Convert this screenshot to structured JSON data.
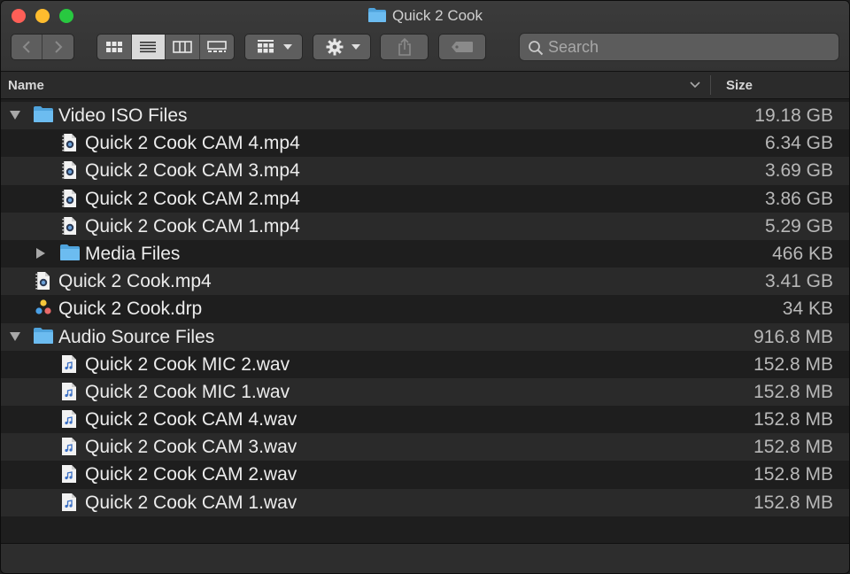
{
  "window": {
    "title": "Quick 2 Cook"
  },
  "toolbar": {
    "view_modes": [
      "icon-view",
      "list-view",
      "column-view",
      "gallery-view"
    ],
    "active_view": "list-view",
    "search_placeholder": "Search"
  },
  "columns": {
    "name": "Name",
    "size": "Size"
  },
  "rows": [
    {
      "name": "Video ISO Files",
      "size": "19.18 GB",
      "kind": "folder",
      "level": 0,
      "disclosure": "open"
    },
    {
      "name": "Quick 2 Cook CAM 4.mp4",
      "size": "6.34 GB",
      "kind": "video",
      "level": 1,
      "disclosure": "none"
    },
    {
      "name": "Quick 2 Cook CAM 3.mp4",
      "size": "3.69 GB",
      "kind": "video",
      "level": 1,
      "disclosure": "none"
    },
    {
      "name": "Quick 2 Cook CAM 2.mp4",
      "size": "3.86 GB",
      "kind": "video",
      "level": 1,
      "disclosure": "none"
    },
    {
      "name": "Quick 2 Cook CAM 1.mp4",
      "size": "5.29 GB",
      "kind": "video",
      "level": 1,
      "disclosure": "none"
    },
    {
      "name": "Media Files",
      "size": "466 KB",
      "kind": "folder",
      "level": 1,
      "disclosure": "closed"
    },
    {
      "name": "Quick 2 Cook.mp4",
      "size": "3.41 GB",
      "kind": "video",
      "level": 0,
      "disclosure": "none"
    },
    {
      "name": "Quick 2 Cook.drp",
      "size": "34 KB",
      "kind": "resolve",
      "level": 0,
      "disclosure": "none"
    },
    {
      "name": "Audio Source Files",
      "size": "916.8 MB",
      "kind": "folder",
      "level": 0,
      "disclosure": "open"
    },
    {
      "name": "Quick 2 Cook MIC 2.wav",
      "size": "152.8 MB",
      "kind": "audio",
      "level": 1,
      "disclosure": "none"
    },
    {
      "name": "Quick 2 Cook MIC 1.wav",
      "size": "152.8 MB",
      "kind": "audio",
      "level": 1,
      "disclosure": "none"
    },
    {
      "name": "Quick 2 Cook CAM 4.wav",
      "size": "152.8 MB",
      "kind": "audio",
      "level": 1,
      "disclosure": "none"
    },
    {
      "name": "Quick 2 Cook CAM 3.wav",
      "size": "152.8 MB",
      "kind": "audio",
      "level": 1,
      "disclosure": "none"
    },
    {
      "name": "Quick 2 Cook CAM 2.wav",
      "size": "152.8 MB",
      "kind": "audio",
      "level": 1,
      "disclosure": "none"
    },
    {
      "name": "Quick 2 Cook CAM 1.wav",
      "size": "152.8 MB",
      "kind": "audio",
      "level": 1,
      "disclosure": "none"
    }
  ],
  "colors": {
    "folder": "#5fb0e6",
    "row_even": "#1e1e1e",
    "row_odd": "#2a2a2a",
    "close": "#fe5f57",
    "minimize": "#febc2e",
    "maximize": "#28c840"
  }
}
